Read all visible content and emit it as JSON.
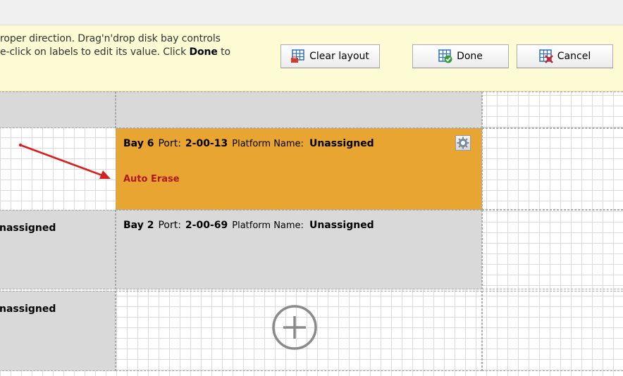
{
  "banner": {
    "line1": "roper direction. Drag'n'drop disk bay controls",
    "line2_prefix": "e-click on labels to edit its value. Click ",
    "line2_bold": "Done",
    "line2_suffix": " to"
  },
  "buttons": {
    "clear": "Clear layout",
    "done": "Done",
    "cancel": "Cancel"
  },
  "bays": [
    {
      "bay_label": "Bay 6",
      "port_label": "Port:",
      "port_value": "2-00-13",
      "platform_label": "Platform Name:",
      "platform_value": "Unassigned",
      "status": "Auto Erase"
    },
    {
      "bay_label": "Bay 2",
      "port_label": "Port:",
      "port_value": "2-00-69",
      "platform_label": "Platform Name:",
      "platform_value": "Unassigned"
    }
  ],
  "partial_cells": [
    "nassigned",
    "nassigned"
  ],
  "icons": [
    "clear-layout-icon",
    "done-icon",
    "cancel-icon",
    "gear-icon",
    "add-icon",
    "annotation-arrow"
  ],
  "colors": {
    "banner_bg": "#fdfbd4",
    "selected_bay_bg": "#e8a531",
    "bay_bg": "#d9d9d9",
    "status_text": "#b01818",
    "arrow": "#d42020"
  }
}
